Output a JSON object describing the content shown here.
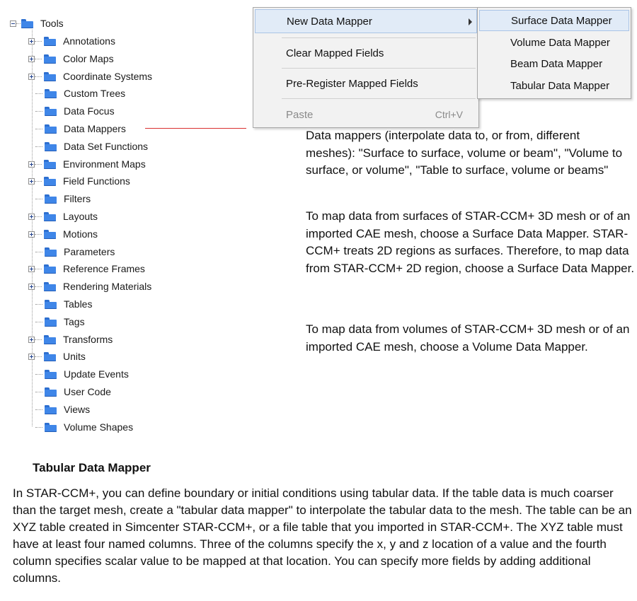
{
  "tree": {
    "root": "Tools",
    "children": [
      {
        "label": "Annotations",
        "expandable": true
      },
      {
        "label": "Color Maps",
        "expandable": true
      },
      {
        "label": "Coordinate Systems",
        "expandable": true
      },
      {
        "label": "Custom Trees",
        "expandable": false
      },
      {
        "label": "Data Focus",
        "expandable": false
      },
      {
        "label": "Data Mappers",
        "expandable": false
      },
      {
        "label": "Data Set Functions",
        "expandable": false
      },
      {
        "label": "Environment Maps",
        "expandable": true
      },
      {
        "label": "Field Functions",
        "expandable": true
      },
      {
        "label": "Filters",
        "expandable": false
      },
      {
        "label": "Layouts",
        "expandable": true
      },
      {
        "label": "Motions",
        "expandable": true
      },
      {
        "label": "Parameters",
        "expandable": false
      },
      {
        "label": "Reference Frames",
        "expandable": true
      },
      {
        "label": "Rendering Materials",
        "expandable": true
      },
      {
        "label": "Tables",
        "expandable": false
      },
      {
        "label": "Tags",
        "expandable": false
      },
      {
        "label": "Transforms",
        "expandable": true
      },
      {
        "label": "Units",
        "expandable": true
      },
      {
        "label": "Update Events",
        "expandable": false
      },
      {
        "label": "User Code",
        "expandable": false
      },
      {
        "label": "Views",
        "expandable": false
      },
      {
        "label": "Volume Shapes",
        "expandable": false
      }
    ]
  },
  "context_menu": {
    "new_data_mapper": "New Data Mapper",
    "clear_mapped_fields": "Clear Mapped Fields",
    "pre_register": "Pre-Register Mapped Fields",
    "paste": "Paste",
    "paste_shortcut": "Ctrl+V"
  },
  "submenu": {
    "surface": "Surface Data Mapper",
    "volume": "Volume Data Mapper",
    "beam": "Beam Data Mapper",
    "tabular": "Tabular Data Mapper"
  },
  "text": {
    "p1": "Data mappers (interpolate data to, or from, different meshes): \"Surface to surface, volume or beam\", \"Volume to surface, or volume\", \"Table to surface, volume or beams\"",
    "p2": "To map data from surfaces of STAR-CCM+ 3D mesh or of an imported CAE mesh, choose a Surface Data Mapper. STAR-CCM+ treats 2D regions as surfaces. Therefore, to map data from STAR-CCM+ 2D region, choose a Surface Data Mapper.",
    "p3": "To map data from volumes of STAR-CCM+ 3D mesh or of an imported CAE mesh, choose a Volume Data Mapper.",
    "heading": "Tabular Data Mapper",
    "p4": "In STAR-CCM+, you can define boundary or initial conditions using tabular data. If the table data is much coarser than the target mesh, create a \"tabular data mapper\" to interpolate the tabular data to the mesh. The table can be an XYZ table created in Simcenter STAR-CCM+, or a file table that you imported in STAR-CCM+. The XYZ table must have at least four named columns. Three of the columns specify the x, y and z location of a value and the fourth column specifies scalar value to be mapped at that location. You can specify more fields by adding additional columns."
  }
}
